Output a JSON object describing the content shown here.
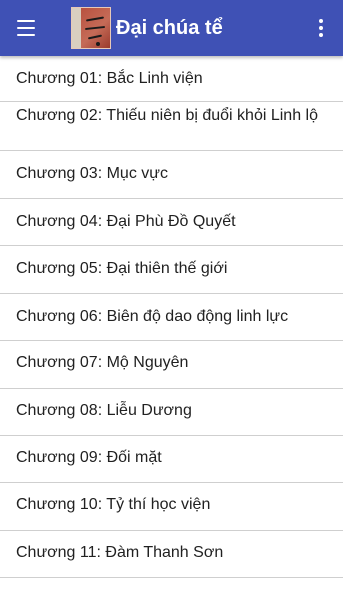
{
  "app_bar": {
    "title": "Đại chúa tể",
    "background": "#3f51b5",
    "logo_text": "Tiên hiệp Đại chúa tể",
    "menu_icon": "hamburger-menu-icon",
    "overflow_icon": "more-vert-icon"
  },
  "chapters": [
    {
      "label": "Chương 01: Bắc Linh viện"
    },
    {
      "label": "Chương 02: Thiếu niên bị đuổi khỏi Linh lộ"
    },
    {
      "label": "Chương 03: Mục vực"
    },
    {
      "label": "Chương 04: Đại Phù Đồ Quyết"
    },
    {
      "label": "Chương 05: Đại thiên thế giới"
    },
    {
      "label": "Chương 06: Biên độ dao động linh lực"
    },
    {
      "label": "Chương 07: Mộ Nguyên"
    },
    {
      "label": "Chương 08: Liễu Dương"
    },
    {
      "label": "Chương 09: Đối mặt"
    },
    {
      "label": "Chương 10: Tỷ thí học viện"
    },
    {
      "label": "Chương 11: Đàm Thanh Sơn"
    }
  ]
}
